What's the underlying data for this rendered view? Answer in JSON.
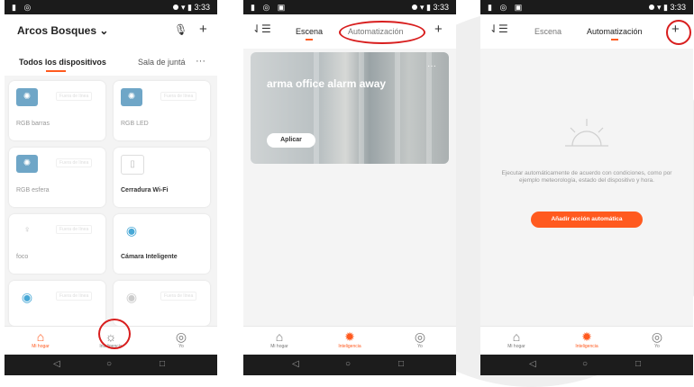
{
  "status_time": "3:33",
  "tab_bar": {
    "home": "Mi hogar",
    "smart": "Inteligencia",
    "me": "Yo"
  },
  "panel1": {
    "home_name": "Arcos Bosques",
    "subtabs": [
      "Todos los dispositivos",
      "Sala de juntá"
    ],
    "devices": [
      {
        "name": "RGB barras",
        "status": "Fuera de línea"
      },
      {
        "name": "RGB LED",
        "status": "Fuera de línea"
      },
      {
        "name": "RGB esfera",
        "status": "Fuera de línea"
      },
      {
        "name": "Cerradura Wi-Fi",
        "status": ""
      },
      {
        "name": "foco",
        "status": "Fuera de línea"
      },
      {
        "name": "Cámara Inteligente",
        "status": ""
      },
      {
        "name": "",
        "status": "Fuera de línea"
      },
      {
        "name": "",
        "status": "Fuera de línea"
      }
    ]
  },
  "panel2": {
    "tabs": [
      "Escena",
      "Automatización"
    ],
    "scene_title": "arma office alarm away",
    "apply_label": "Aplicar"
  },
  "panel3": {
    "tabs": [
      "Escena",
      "Automatización"
    ],
    "empty_text": "Ejecutar automáticamente de acuerdo con condiciones, como por ejemplo meteorología, estado del dispositivo y hora.",
    "cta_label": "Añadir acción automática"
  },
  "icons": {
    "more": "more-icon",
    "add": "plus-icon",
    "mic": "mic-icon",
    "sort": "sort-icon"
  },
  "colors": {
    "accent": "#ff5a1f",
    "annotation_ring": "#d81e1e"
  }
}
